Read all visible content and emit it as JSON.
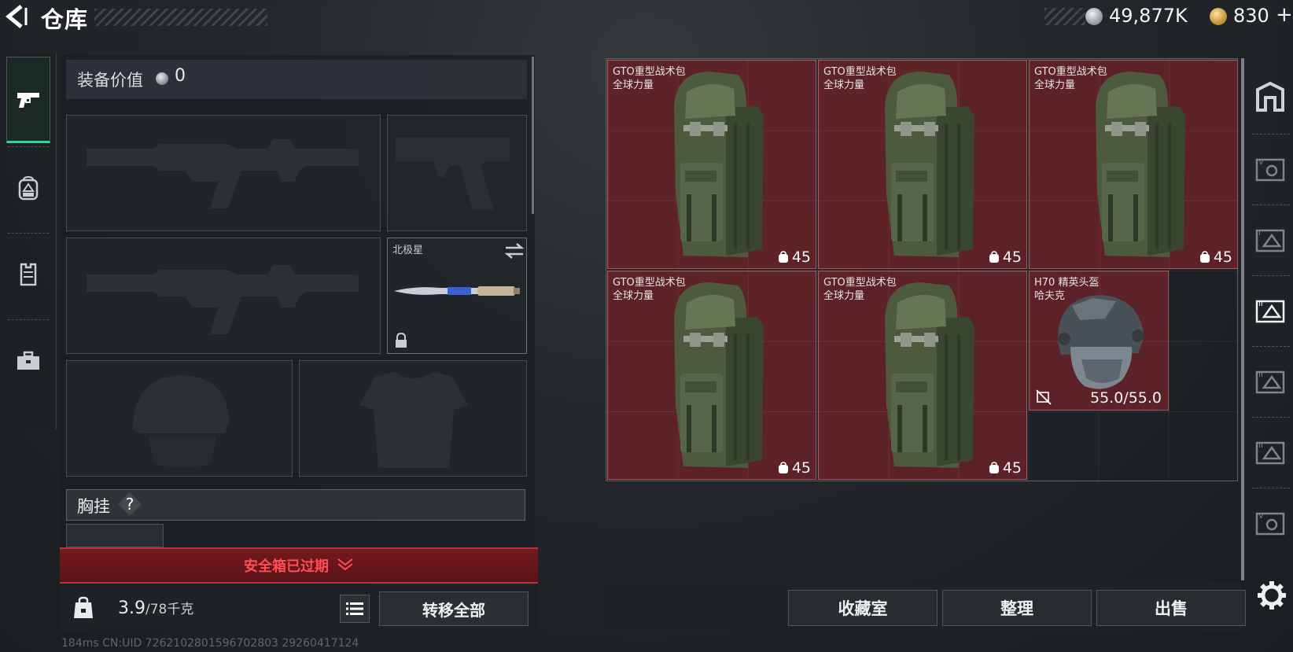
{
  "header": {
    "back_icon": "back-arrow-icon",
    "title": "仓库",
    "currency": {
      "silver_amount": "49,877K",
      "gold_amount": "830",
      "gold_add_label": "+"
    }
  },
  "left_tabs": [
    {
      "icon": "pistol-icon",
      "active": true
    },
    {
      "icon": "backpack-icon",
      "active": false
    },
    {
      "icon": "vest-icon",
      "active": false
    },
    {
      "icon": "briefcase-icon",
      "active": false
    }
  ],
  "loadout": {
    "equipment_value_label": "装备价值",
    "equipment_value": "0",
    "melee_slot": {
      "name": "北极星",
      "locked": true
    },
    "chest_rig_label": "胸挂",
    "chest_rig_help": "?",
    "safebox_text": "安全箱已过期",
    "weight_value": "3.9",
    "weight_max": "/78千克",
    "transfer_all_label": "转移全部"
  },
  "stash": {
    "items": [
      {
        "name": "GTO重型战术包",
        "sub": "全球力量",
        "capacity": "45",
        "type": "backpack"
      },
      {
        "name": "GTO重型战术包",
        "sub": "全球力量",
        "capacity": "45",
        "type": "backpack"
      },
      {
        "name": "GTO重型战术包",
        "sub": "全球力量",
        "capacity": "45",
        "type": "backpack"
      },
      {
        "name": "GTO重型战术包",
        "sub": "全球力量",
        "capacity": "45",
        "type": "backpack"
      },
      {
        "name": "GTO重型战术包",
        "sub": "全球力量",
        "capacity": "45",
        "type": "backpack"
      },
      {
        "name": "H70 精英头盔",
        "sub": "哈夫克",
        "durability": "55.0/55.0",
        "type": "helmet"
      }
    ]
  },
  "right_tabs": [
    "home-icon",
    "stash-tier-4-icon",
    "stash-tier-2-icon",
    "stash-tier-3-icon",
    "stash-tier-3b-icon",
    "stash-tier-3c-icon",
    "stash-tier-4b-icon"
  ],
  "actions": {
    "collection_room": "收藏室",
    "organize": "整理",
    "sell": "出售"
  },
  "footer": {
    "text": "184ms   CN:UID 7262102801596702803 29260417124"
  },
  "colors": {
    "accent_green": "#2fd59a",
    "item_bg": "#702228",
    "alert_red": "#ff4e55"
  }
}
